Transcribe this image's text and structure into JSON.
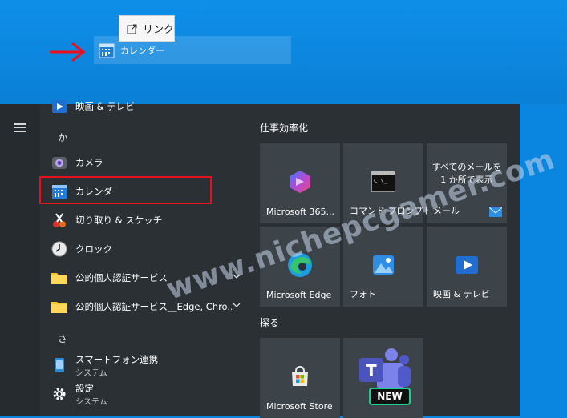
{
  "drag": {
    "tooltip_label": "リンク",
    "ghost_label": "カレンダー"
  },
  "colors": {
    "accent": "#0a86e0",
    "start_bg": "#2b3035",
    "tile_bg": "#3d4449",
    "highlight": "#e8101d"
  },
  "app_list": {
    "items": [
      {
        "label": "映画 & テレビ",
        "icon": "movies-tv-icon"
      },
      {
        "label": "か",
        "type": "letter"
      },
      {
        "label": "カメラ",
        "icon": "camera-icon"
      },
      {
        "label": "カレンダー",
        "icon": "calendar-icon"
      },
      {
        "label": "切り取り & スケッチ",
        "icon": "snip-sketch-icon"
      },
      {
        "label": "クロック",
        "icon": "clock-icon"
      },
      {
        "label": "公的個人認証サービス",
        "icon": "folder-icon"
      },
      {
        "label": "公的個人認証サービス__Edge, Chro...",
        "icon": "folder-icon"
      },
      {
        "label": "さ",
        "type": "letter"
      },
      {
        "label": "スマートフォン連携",
        "sub": "システム",
        "icon": "phone-link-icon"
      },
      {
        "label": "設定",
        "sub": "システム",
        "icon": "settings-gear-icon"
      }
    ]
  },
  "tiles": {
    "group1_title": "仕事効率化",
    "group2_title": "探る",
    "items": [
      {
        "label": "Microsoft 365...",
        "icon": "microsoft365-icon"
      },
      {
        "label": "コマンド プロンプト",
        "icon": "command-prompt-icon"
      },
      {
        "label": "メール",
        "text": "すべてのメールを 1 か所で表示",
        "icon": "mail-icon"
      },
      {
        "label": "Microsoft Edge",
        "icon": "edge-icon"
      },
      {
        "label": "フォト",
        "icon": "photos-icon"
      },
      {
        "label": "映画 & テレビ",
        "icon": "movies-tv-icon"
      },
      {
        "label": "Microsoft Store",
        "icon": "store-icon"
      },
      {
        "label": "",
        "badge": "NEW",
        "icon": "teams-icon"
      }
    ]
  },
  "watermark": "www.nichepcgamer.com"
}
